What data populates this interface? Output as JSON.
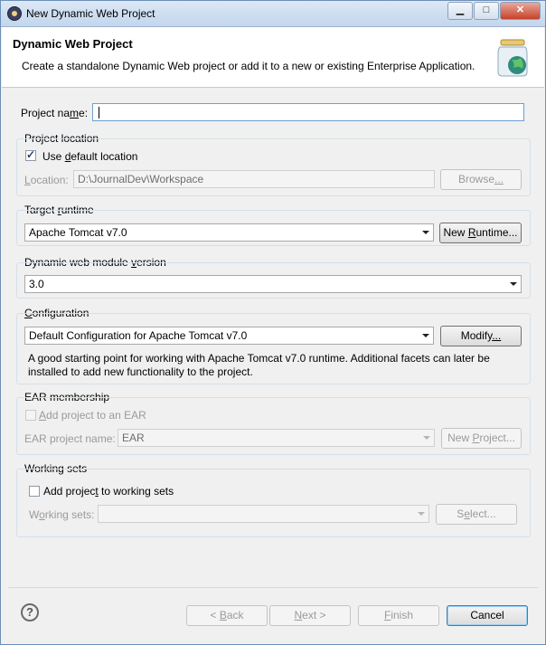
{
  "window": {
    "title": "New Dynamic Web Project",
    "minimize": "▁",
    "maximize": "□",
    "close": "✕"
  },
  "banner": {
    "title": "Dynamic Web Project",
    "description": "Create a standalone Dynamic Web project or add it to a new or existing Enterprise Application."
  },
  "project_name": {
    "label_pre": "Project na",
    "label_mnemonic": "m",
    "label_post": "e:",
    "value": ""
  },
  "location": {
    "group": "Project location",
    "use_default_pre": "Use ",
    "use_default_mnemonic": "d",
    "use_default_post": "efault location",
    "use_default_checked": true,
    "label_mnemonic": "L",
    "label_post": "ocation:",
    "value": "D:\\JournalDev\\Workspace",
    "browse_pre": "Browse",
    "browse_mnemonic": "...",
    "browse_post": ""
  },
  "runtime": {
    "group_pre": "Target ",
    "group_mnemonic": "r",
    "group_post": "untime",
    "selected": "Apache Tomcat v7.0",
    "new_pre": "New ",
    "new_mnemonic": "R",
    "new_post": "untime..."
  },
  "module": {
    "group_pre": "Dynamic web module ",
    "group_mnemonic": "v",
    "group_post": "ersion",
    "selected": "3.0"
  },
  "configuration": {
    "group_mnemonic": "C",
    "group_post": "onfiguration",
    "selected": "Default Configuration for Apache Tomcat v7.0",
    "modify_pre": "Modify",
    "modify_mnemonic": "...",
    "modify_post": "",
    "desc_line1": "A good starting point for working with Apache Tomcat v7.0 runtime. Additional facets can later be",
    "desc_line2": "installed to add new functionality to the project."
  },
  "ear": {
    "group": "EAR membership",
    "add_mnemonic": "A",
    "add_post": "dd project to an EAR",
    "name_pre": "EAR pro",
    "name_mnemonic": "j",
    "name_post": "ect name:",
    "value": "EAR",
    "new_pre": "New ",
    "new_mnemonic": "P",
    "new_post": "roject..."
  },
  "working_sets": {
    "group": "Working sets",
    "add_pre": "Add projec",
    "add_mnemonic": "t",
    "add_post": " to working sets",
    "label_pre": "W",
    "label_mnemonic": "o",
    "label_post": "rking sets:",
    "select_pre": "S",
    "select_mnemonic": "e",
    "select_post": "lect..."
  },
  "footer": {
    "help": "?",
    "back_pre": "< ",
    "back_mnemonic": "B",
    "back_post": "ack",
    "next_mnemonic": "N",
    "next_post": "ext >",
    "finish_mnemonic": "F",
    "finish_post": "inish",
    "cancel": "Cancel"
  }
}
